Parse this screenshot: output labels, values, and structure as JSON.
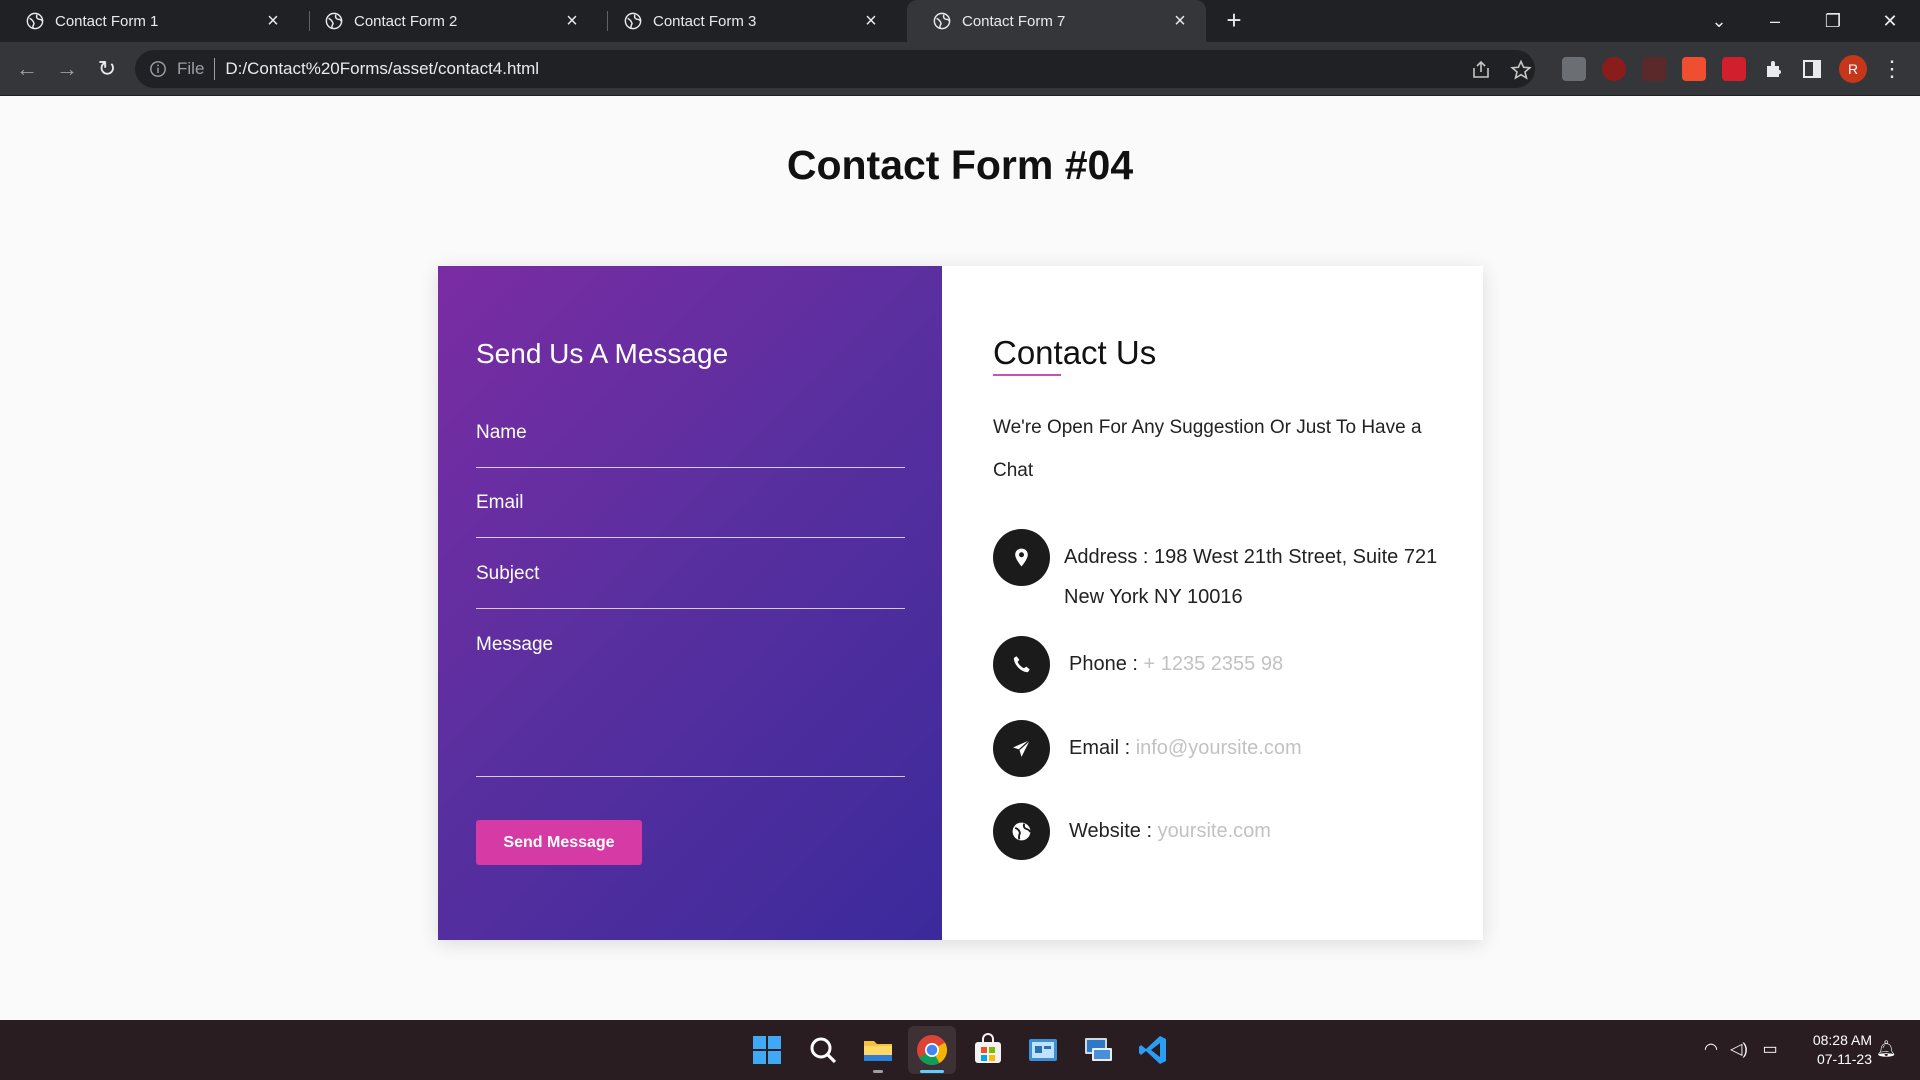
{
  "browser": {
    "tabs": [
      {
        "title": "Contact Form 1"
      },
      {
        "title": "Contact Form 2"
      },
      {
        "title": "Contact Form 3"
      },
      {
        "title": "Contact Form 7"
      }
    ],
    "active_tab_index": 3,
    "omnibox": {
      "scheme_label": "File",
      "url": "D:/Contact%20Forms/asset/contact4.html"
    },
    "profile_initial": "R"
  },
  "page": {
    "title": "Contact Form #04",
    "form": {
      "heading": "Send Us A Message",
      "name_placeholder": "Name",
      "email_placeholder": "Email",
      "subject_placeholder": "Subject",
      "message_placeholder": "Message",
      "submit_label": "Send Message"
    },
    "contact": {
      "heading": "Contact Us",
      "intro": "We're Open For Any Suggestion Or Just To Have a Chat",
      "address_label": "Address :",
      "address_line1": "198 West 21th Street, Suite 721",
      "address_line2": "New York NY 10016",
      "phone_label": "Phone :",
      "phone_value": "+ 1235 2355 98",
      "email_label": "Email :",
      "email_value": "info@yoursite.com",
      "website_label": "Website :",
      "website_value": "yoursite.com"
    },
    "colors": {
      "gradient_start": "#7b2ca4",
      "gradient_end": "#3b2a9b",
      "button": "#d63aa4",
      "icon_circle": "#1b1b1b",
      "muted_text": "#c2c2c2"
    }
  },
  "taskbar": {
    "time": "08:28 AM",
    "date": "07-11-23"
  }
}
